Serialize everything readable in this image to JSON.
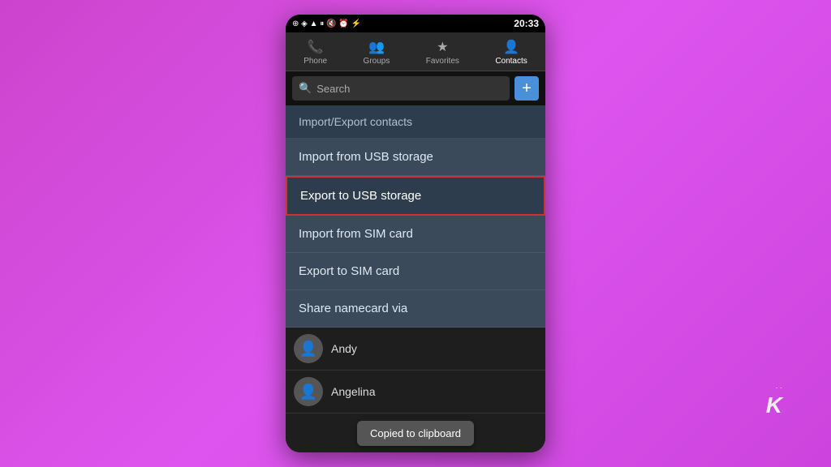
{
  "background": {
    "gradient_start": "#cc44cc",
    "gradient_end": "#dd55ee"
  },
  "status_bar": {
    "time": "20:33",
    "icons": "◉ ◈ ▲ ▐▐ ✕ ⏰ ⚡ 1 ▉▉ ▉▉"
  },
  "nav_tabs": [
    {
      "label": "Phone",
      "icon": "📞",
      "active": false
    },
    {
      "label": "Groups",
      "icon": "👥",
      "active": false
    },
    {
      "label": "Favorites",
      "icon": "★",
      "active": false
    },
    {
      "label": "Contacts",
      "icon": "👤",
      "active": true
    }
  ],
  "search": {
    "placeholder": "Search",
    "add_btn_label": "+"
  },
  "menu": {
    "title": "Import/Export contacts",
    "items": [
      {
        "id": "import-usb",
        "label": "Import from USB storage",
        "selected": false
      },
      {
        "id": "export-usb",
        "label": "Export to USB storage",
        "selected": true
      },
      {
        "id": "import-sim",
        "label": "Import from SIM card",
        "selected": false
      },
      {
        "id": "export-sim",
        "label": "Export to SIM card",
        "selected": false
      },
      {
        "id": "share-namecard",
        "label": "Share namecard via",
        "selected": false
      }
    ]
  },
  "contacts": [
    {
      "name": "Andy"
    },
    {
      "name": "Angelina"
    }
  ],
  "toast": {
    "message": "Copied to clipboard"
  },
  "branding": {
    "logo": "K",
    "dots": "··"
  }
}
